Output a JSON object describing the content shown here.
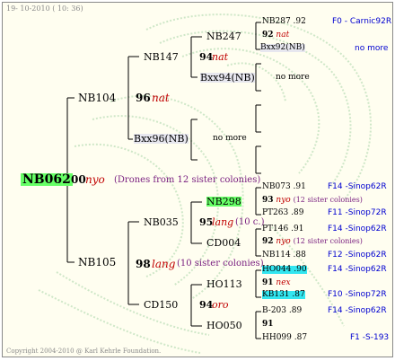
{
  "header": {
    "date": "19- 10-2010 ( 10: 36)"
  },
  "footer": {
    "copyright": "Copyright 2004-2010 @ Karl Kehrle Foundation."
  },
  "root": {
    "id": "NB062",
    "score": "00",
    "label": "nyo",
    "note": "(Drones from 12 sister colonies)"
  },
  "gen1": {
    "upper": "NB104",
    "lower": "NB105"
  },
  "gen2": {
    "a": "NB147",
    "a_score": "96",
    "a_label": "nat",
    "b": "Bxx96(NB)",
    "b_nomore": "no more",
    "c": "NB035",
    "c_score": "98",
    "c_label": "lang",
    "c_note": "(10 sister colonies)",
    "d": "CD150"
  },
  "gen3": {
    "a": "NB247",
    "a_score": "94",
    "a_label": "nat",
    "b": "Bxx94(NB)",
    "b_nomore": "no more",
    "c": "NB298",
    "c_score": "95",
    "c_label": "lang",
    "c_note": "(10 c.)",
    "d": "CD004",
    "e": "HO113",
    "e_score": "94",
    "e_label": "oro",
    "f": "HO050"
  },
  "gen4": [
    {
      "name": "NB287",
      "val": ".92",
      "right": "F0 - Carnic92R"
    },
    {
      "score": "92",
      "label": "nat"
    },
    {
      "name": "Bxx92(NB)",
      "right": "no more"
    },
    {
      "name": "NB073",
      "val": ".91",
      "right": "F14 -Sinop62R"
    },
    {
      "score": "93",
      "label": "nyo",
      "note": "(12 sister colonies)"
    },
    {
      "name": "PT263",
      "val": ".89",
      "right": "F11 -Sinop72R"
    },
    {
      "name": "PT146",
      "val": ".91",
      "right": "F14 -Sinop62R"
    },
    {
      "score": "92",
      "label": "nyo",
      "note": "(12 sister colonies)"
    },
    {
      "name": "NB114",
      "val": ".88",
      "right": "F12 -Sinop62R"
    },
    {
      "name": "HO044",
      "val": ".90",
      "right": "F14 -Sinop62R"
    },
    {
      "score": "91",
      "label": "nex"
    },
    {
      "name": "KB131",
      "val": ".87",
      "right": "F10 -Sinop72R"
    },
    {
      "name": "B-203",
      "val": ".89",
      "right": "F14 -Sinop62R"
    },
    {
      "score": "91"
    },
    {
      "name": "HH099",
      "val": ".87",
      "right": "F1 -S-193"
    }
  ]
}
